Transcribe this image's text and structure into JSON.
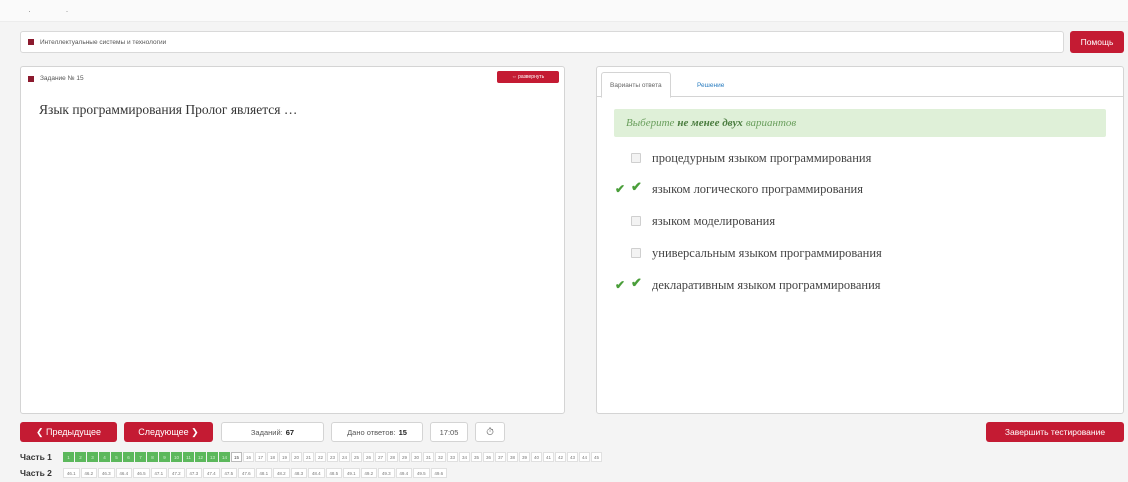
{
  "course": {
    "title": "Интеллектуальные системы и технологии"
  },
  "help_label": "Помощь",
  "question": {
    "header": "Задание № 15",
    "expand_label": "⇔ развернуть",
    "text": "Язык программирования Пролог является …"
  },
  "answer_panel": {
    "tabs": [
      "Варианты ответа",
      "Решение"
    ],
    "hint_before": "Выберите",
    "hint_bold": "не менее двух",
    "hint_after": "вариантов",
    "options": [
      {
        "label": "процедурным языком программирования",
        "checked": false,
        "correct": false
      },
      {
        "label": "языком логического программирования",
        "checked": true,
        "correct": true
      },
      {
        "label": "языком моделирования",
        "checked": false,
        "correct": false
      },
      {
        "label": "универсальным языком программирования",
        "checked": false,
        "correct": false
      },
      {
        "label": "декларативным языком программирования",
        "checked": true,
        "correct": true
      }
    ]
  },
  "bottom": {
    "prev_label": "❮ Предыдущее",
    "next_label": "Следующее ❯",
    "tasks_label": "Заданий:",
    "tasks_value": "67",
    "answered_label": "Дано ответов:",
    "answered_value": "15",
    "timer": "17:05",
    "timer_icon": "clock-icon",
    "finish_label": "Завершить тестирование"
  },
  "parts": {
    "part1_label": "Часть 1",
    "part2_label": "Часть 2",
    "part1_cells": [
      "1",
      "2",
      "3",
      "4",
      "5",
      "6",
      "7",
      "8",
      "9",
      "10",
      "11",
      "12",
      "13",
      "14",
      "15",
      "16",
      "17",
      "18",
      "19",
      "20",
      "21",
      "22",
      "23",
      "24",
      "25",
      "26",
      "27",
      "28",
      "29",
      "30",
      "31",
      "32",
      "33",
      "34",
      "35",
      "36",
      "37",
      "38",
      "39",
      "40",
      "41",
      "42",
      "43",
      "44",
      "45"
    ],
    "part1_done": 14,
    "part1_current": "15",
    "part2_cells": [
      "46.1",
      "46.2",
      "46.3",
      "46.4",
      "46.5",
      "47.1",
      "47.2",
      "47.3",
      "47.4",
      "47.5",
      "47.6",
      "48.1",
      "48.2",
      "48.3",
      "48.4",
      "48.5",
      "49.1",
      "49.2",
      "49.3",
      "49.4",
      "49.5",
      "49.6"
    ]
  },
  "colors": {
    "accent": "#c41b33",
    "success": "#5cb85c",
    "hint_bg": "#dff0d8"
  }
}
